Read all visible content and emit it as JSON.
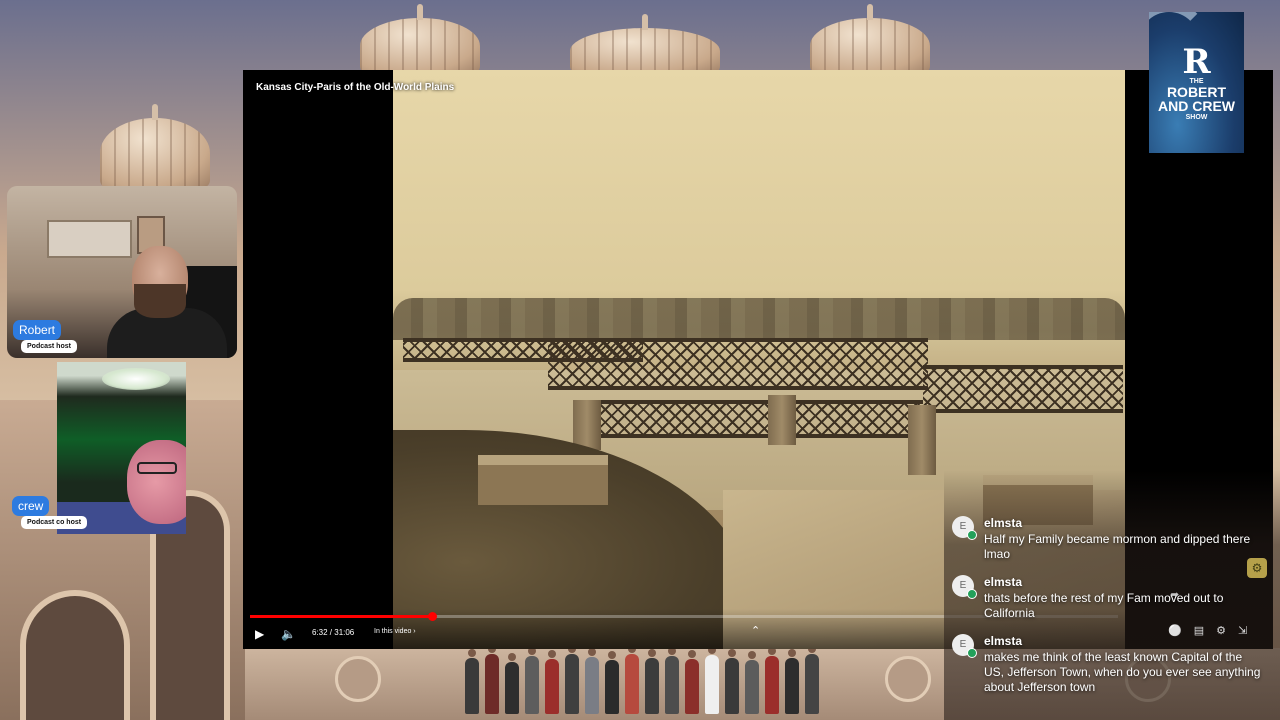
{
  "video": {
    "title": "Kansas City-Paris of the Old-World Plains",
    "time": "6:32 / 31:06",
    "in_this_video": "In this video",
    "progress_fraction": 0.21
  },
  "cams": [
    {
      "name": "Robert",
      "role": "Podcast host"
    },
    {
      "name": "crew",
      "role": "Podcast co host"
    }
  ],
  "logo": {
    "letter": "R",
    "line1": "THE",
    "line2a": "ROBERT",
    "line2b": "AND CREW",
    "line3": "SHOW"
  },
  "chat": {
    "messages": [
      {
        "avatar": "E",
        "user": "elmsta",
        "text": "Half my Family became mormon and dipped there lmao"
      },
      {
        "avatar": "E",
        "user": "elmsta",
        "text": "thats before the rest of my Fam moved out to California"
      },
      {
        "avatar": "E",
        "user": "elmsta",
        "text": "makes me think of the least known Capital of the US, Jefferson Town, when do you ever see anything about Jefferson town"
      }
    ]
  },
  "icons": {
    "play": "play-icon",
    "volume": "volume-icon",
    "chevron_up": "chevron-up-icon",
    "settings": "gear-icon",
    "captions": "captions-icon",
    "autoplay": "autoplay-toggle-icon",
    "minimize": "minimize-icon",
    "share": "share-icon"
  },
  "colors": {
    "progress": "#ff0000",
    "name_tag": "#2d7be0",
    "badge": "#22a05a"
  }
}
